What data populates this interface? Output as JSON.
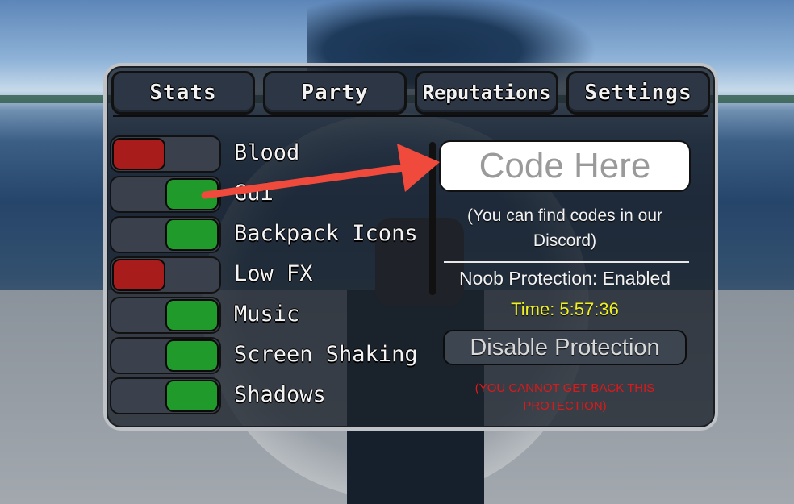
{
  "tabs": [
    "Stats",
    "Party",
    "Reputations",
    "Settings"
  ],
  "toggles": [
    {
      "label": "Blood",
      "state": "off"
    },
    {
      "label": "Gui",
      "state": "on"
    },
    {
      "label": "Backpack Icons",
      "state": "on"
    },
    {
      "label": "Low FX",
      "state": "off"
    },
    {
      "label": "Music",
      "state": "on"
    },
    {
      "label": "Screen Shaking",
      "state": "on"
    },
    {
      "label": "Shadows",
      "state": "on"
    }
  ],
  "code_box": {
    "placeholder": "Code Here"
  },
  "hint": "(You can find codes in our Discord)",
  "noob_protection": "Noob Protection: Enabled",
  "timer": "Time: 5:57:36",
  "disable_button": "Disable Protection",
  "warning": "(YOU CANNOT GET BACK THIS PROTECTION)",
  "colors": {
    "toggle_on": "#1f9a2b",
    "toggle_off": "#a91c1c",
    "timer": "#f0f023",
    "warning": "#e01818",
    "arrow": "#f04a3c"
  }
}
